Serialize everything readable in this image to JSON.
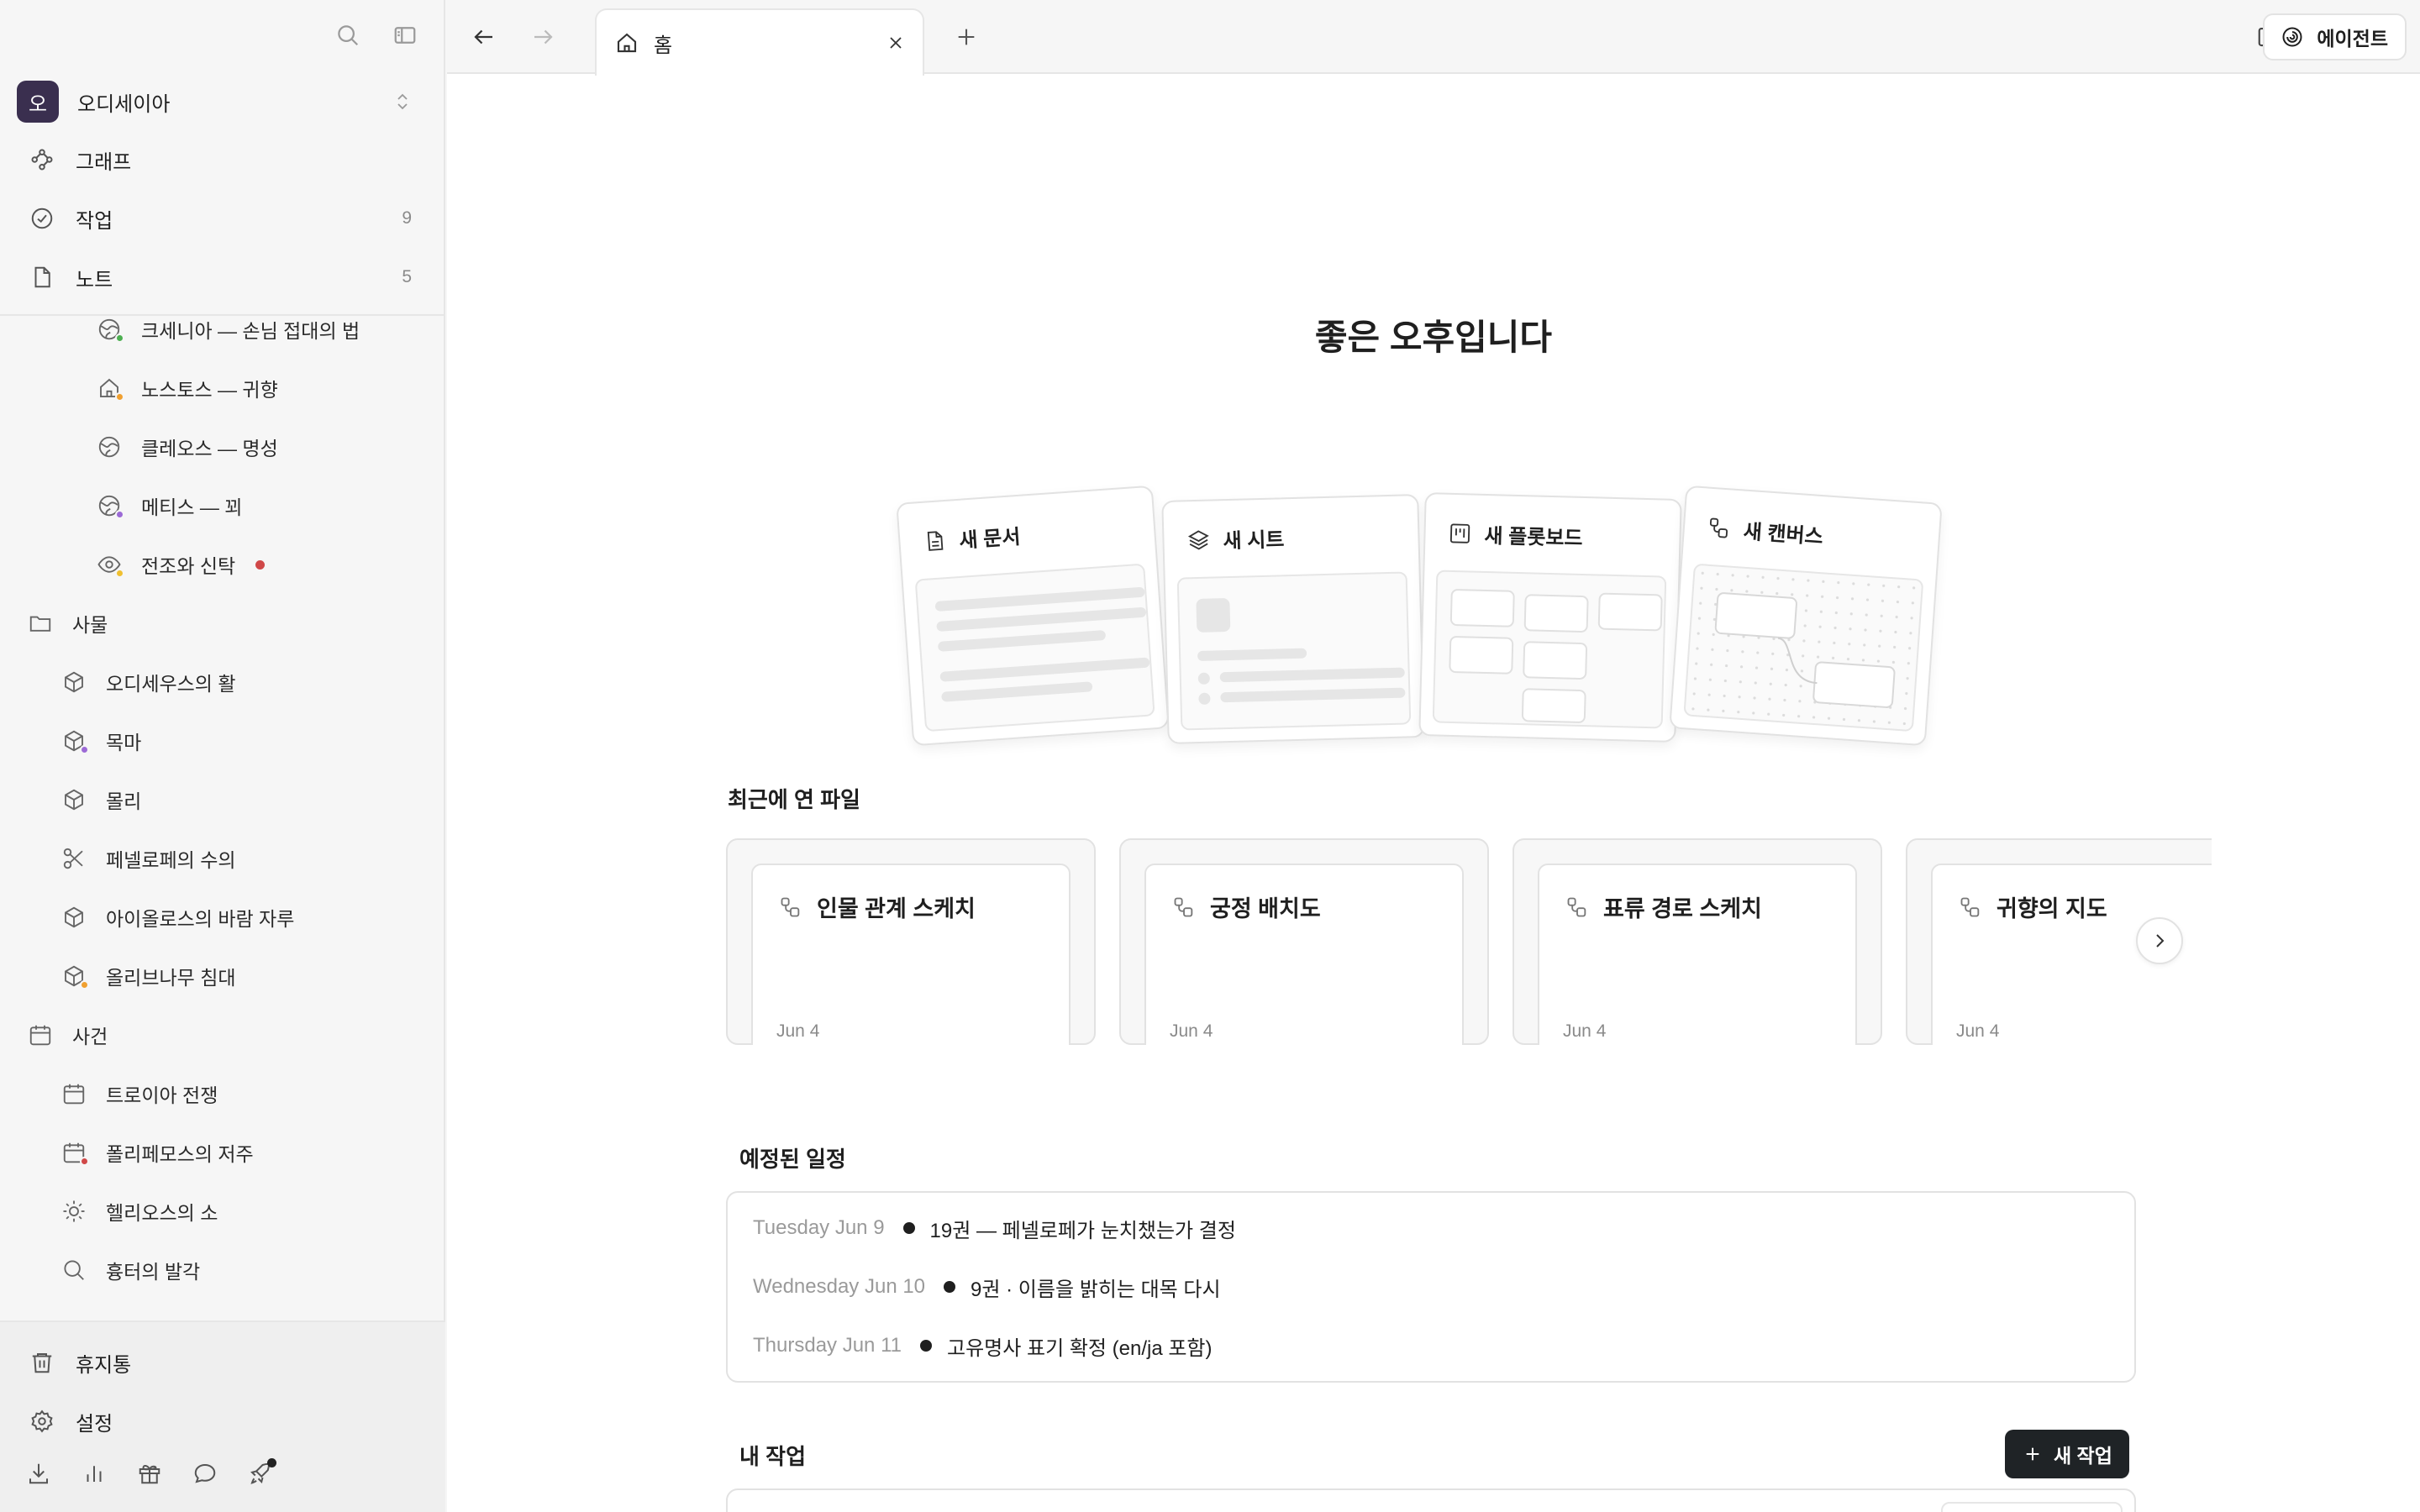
{
  "sidebar": {
    "workspace": {
      "avatar": "오",
      "name": "오디세이아"
    },
    "nav": [
      {
        "label": "그래프",
        "count": ""
      },
      {
        "label": "작업",
        "count": "9"
      },
      {
        "label": "노트",
        "count": "5"
      }
    ],
    "tree": [
      {
        "label": "크세니아 — 손님 접대의 법",
        "icon": "globe-icon",
        "dot": "#4caf50"
      },
      {
        "label": "노스토스 — 귀향",
        "icon": "home-icon",
        "dot": "#f0a030"
      },
      {
        "label": "클레오스 — 명성",
        "icon": "globe-icon",
        "dot": ""
      },
      {
        "label": "메티스 — 꾀",
        "icon": "globe-icon",
        "dot": "#9c6ad6"
      },
      {
        "label": "전조와 신탁",
        "icon": "eye-icon",
        "dot": "#f0c030",
        "trailing_dot": "#d04848"
      },
      {
        "label": "사물",
        "icon": "folder-icon",
        "dot": ""
      },
      {
        "label": "오디세우스의 활",
        "icon": "cube-icon",
        "dot": ""
      },
      {
        "label": "목마",
        "icon": "cube-icon",
        "dot": "#9c6ad6"
      },
      {
        "label": "몰리",
        "icon": "cube-icon",
        "dot": ""
      },
      {
        "label": "페넬로페의 수의",
        "icon": "scissors-icon",
        "dot": ""
      },
      {
        "label": "아이올로스의 바람 자루",
        "icon": "cube-icon",
        "dot": ""
      },
      {
        "label": "올리브나무 침대",
        "icon": "cube-icon",
        "dot": "#f0a030"
      },
      {
        "label": "사건",
        "icon": "calendar-icon",
        "dot": ""
      },
      {
        "label": "트로이아 전쟁",
        "icon": "calendar-icon",
        "dot": ""
      },
      {
        "label": "폴리페모스의 저주",
        "icon": "calendar-icon",
        "dot": "#d04848"
      },
      {
        "label": "헬리오스의 소",
        "icon": "sun-icon",
        "dot": ""
      },
      {
        "label": "흉터의 발각",
        "icon": "search-icon",
        "dot": ""
      }
    ],
    "footer": [
      {
        "label": "휴지통"
      },
      {
        "label": "설정"
      }
    ]
  },
  "tabbar": {
    "tab_label": "홈",
    "agent_label": "에이전트"
  },
  "home": {
    "greeting": "좋은 오후입니다",
    "create_cards": [
      {
        "label": "새 문서"
      },
      {
        "label": "새 시트"
      },
      {
        "label": "새 플롯보드"
      },
      {
        "label": "새 캔버스"
      }
    ],
    "recent_title": "최근에 연 파일",
    "recent_files": [
      {
        "title": "인물 관계 스케치",
        "date": "Jun 4"
      },
      {
        "title": "궁정 배치도",
        "date": "Jun 4"
      },
      {
        "title": "표류 경로 스케치",
        "date": "Jun 4"
      },
      {
        "title": "귀향의 지도",
        "date": "Jun 4"
      }
    ],
    "schedule_title": "예정된 일정",
    "schedule": [
      {
        "date": "Tuesday Jun 9",
        "title": "19권 — 페넬로페가 눈치챘는가 결정"
      },
      {
        "date": "Wednesday Jun 10",
        "title": "9권 · 이름을 밝히는 대목 다시"
      },
      {
        "date": "Thursday Jun 11",
        "title": "고유명사 표기 확정 (en/ja 포함)"
      }
    ],
    "tasks_title": "내 작업",
    "new_task_label": "새 작업"
  }
}
